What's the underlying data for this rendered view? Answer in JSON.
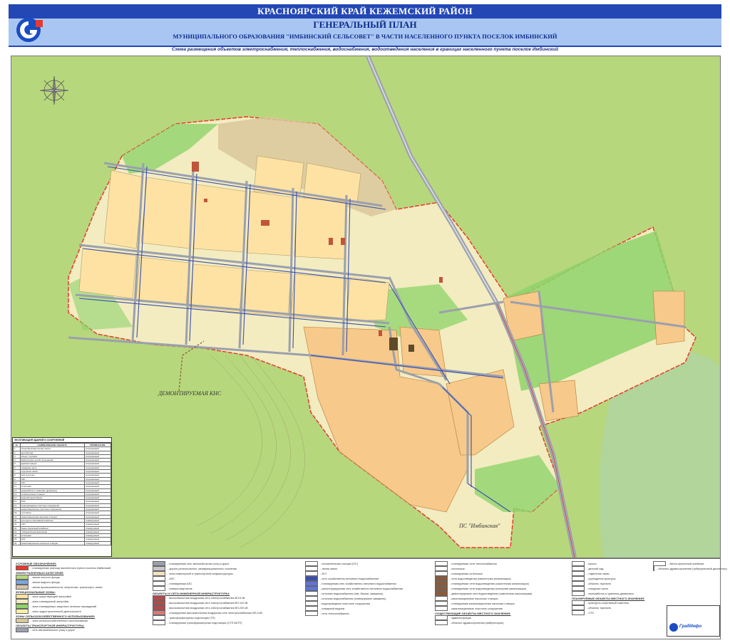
{
  "header": {
    "region": "КРАСНОЯРСКИЙ КРАЙ КЕЖЕМСКИЙ РАЙОН",
    "title": "ГЕНЕРАЛЬНЫЙ ПЛАН",
    "subtitle": "МУНИЦИПАЛЬНОГО ОБРАЗОВАНИЯ \"ИМБИНСКИЙ СЕЛЬСОВЕТ\" В ЧАСТИ НАСЕЛЕННОГО ПУНКТА ПОСЕЛОК ИМБИНСКИЙ",
    "scheme": "Схема размещения объектов электроснабжения, теплоснабжения, водоснабжения, водоотведения населения в границах населенного пункта поселок Имбинский"
  },
  "map_labels": {
    "demolished": "ДЕМОНТИРУЕМАЯ КНС",
    "substation": "ПС \"Имбинская\""
  },
  "colors": {
    "header_dark": "#2347b5",
    "header_light": "#a9c6f3",
    "forest": "#b7d77c",
    "residential": "#fde2a3",
    "public": "#f7c98a",
    "green_zone": "#8ed46a",
    "road": "#9aa0ad",
    "engineering_line": "#3a4fb0",
    "border": "#e53b2e"
  },
  "explication": {
    "title": "ЭКСПЛИКАЦИЯ ЗДАНИЙ И СООРУЖЕНИЙ",
    "columns": [
      "№",
      "НАИМЕНОВАНИЕ ОБЪЕКТА",
      "ПРИМЕЧАНИЕ"
    ],
    "rows": [
      [
        "1",
        "общеобразовательная школа",
        "сохраняемый"
      ],
      [
        "2",
        "детский сад",
        "сохраняемый"
      ],
      [
        "3",
        "объект торговли",
        "сохраняемый"
      ],
      [
        "4",
        "амбулатория (на 40 посещений)",
        "сохраняемый"
      ],
      [
        "5",
        "администрация",
        "сохраняемый"
      ],
      [
        "6",
        "пожарная часть",
        "сохраняемый"
      ],
      [
        "7",
        "отделение связи",
        "сохраняемый"
      ],
      [
        "8",
        "дом культуры",
        "сохраняемый"
      ],
      [
        "9",
        "АЗС",
        "сохраняемый"
      ],
      [
        "10",
        "АТС",
        "сохраняемый"
      ],
      [
        "11",
        "котельная",
        "сохраняемый"
      ],
      [
        "12",
        "переработка и хранение древесины",
        "сохраняемый"
      ],
      [
        "13",
        "понизительная станция",
        "сохраняемый"
      ],
      [
        "14",
        "водонапорная башня",
        "сохраняемый"
      ],
      [
        "15",
        "КНС",
        "сохраняемый"
      ],
      [
        "16",
        "водопроводные очистные сооружения",
        "сохраняемый"
      ],
      [
        "17",
        "канализационные очистные сооружения",
        "сохраняемый"
      ],
      [
        "18",
        "гостиница",
        "сохраняемый"
      ],
      [
        "19",
        "канализационная насосная станция",
        "сохраняемый"
      ],
      [
        "20",
        "культурно-спортивный комплекс",
        "планируемый"
      ],
      [
        "21",
        "СТО",
        "планируемый"
      ],
      [
        "22",
        "банно-прачечный комбинат",
        "планируемый"
      ],
      [
        "23",
        "туберкулёзный диспансер",
        "планируемый"
      ],
      [
        "24",
        "котельная",
        "планируемый"
      ],
      [
        "25",
        "КНС",
        "планируемый"
      ],
      [
        "26",
        "канализационные насосные станции",
        "планируемый"
      ]
    ]
  },
  "legend": {
    "col1": {
      "heading": "УСЛОВНЫЕ ОБОЗНАЧЕНИЯ:",
      "items": [
        {
          "sw": "#e53b2e",
          "text": "- планируемая граница населенного пункта поселок Имбинский"
        },
        {
          "head": "ЗЕМЛИ РАЗЛИЧНЫХ КАТЕГОРИЙ:"
        },
        {
          "sw": "#b7d77c",
          "text": "- земли лесного фонда"
        },
        {
          "sw": "#7aa7e0",
          "text": "- земли водного фонда"
        },
        {
          "sw": "#d6c3a8",
          "text": "- земли промышленности, энергетики, транспорта, связи"
        },
        {
          "head": "ФУНКЦИОНАЛЬНЫЕ ЗОНЫ:"
        },
        {
          "sw": "#fde2a3",
          "text": "- зона существующей застройки"
        },
        {
          "sw": "#f3ecc0",
          "text": "- зона планируемой застройки"
        },
        {
          "sw": "#8ed46a",
          "text": "- зона планируемых защитных зеленых насаждений"
        },
        {
          "sw": "#f9f1a6",
          "text": "- зона градостроительной деятельности"
        },
        {
          "head": "ЗОНЫ СЕЛЬСКОХОЗЯЙСТВЕННОГО ИСПОЛЬЗОВАНИЯ:"
        },
        {
          "sw": "#d9c89a",
          "text": "- зона сельскохозяйственного использования"
        },
        {
          "head": "ОБЪЕКТЫ ТРАНСПОРТНОЙ ИНФРАСТРУКТУРЫ:"
        },
        {
          "sw": "#9aa0ad",
          "text": "- сеть автомобильных улиц и дорог"
        }
      ]
    },
    "col2": {
      "items": [
        {
          "sw": "#9aa0ad",
          "text": "- планируемая сеть автомобильных улиц и дорог"
        },
        {
          "sw": "#c8c8c8",
          "text": "- дороги регионального, межмуниципального значения"
        },
        {
          "sw": "#efe3c0",
          "text": "- зона инженерной и транспортной инфраструктуры"
        },
        {
          "sw": "#ffffff",
          "text": "- АЗС"
        },
        {
          "sw": "#ffffff",
          "text": "- планируемая АЗС"
        },
        {
          "sw": "#ffffff",
          "text": "- номера кварталов"
        },
        {
          "head": "ОБЪЕКТЫ И СЕТИ ИНЖЕНЕРНОЙ ИНФРАСТРУКТУРЫ:"
        },
        {
          "sw": "#b34a4a",
          "text": "- высоковольтная воздушная сеть электроснабжения ВЛ-6 кВ"
        },
        {
          "sw": "#b34a4a",
          "text": "- высоковольтная воздушная сеть электроснабжения ВЛ-110 кВ"
        },
        {
          "sw": "#b34a4a",
          "text": "- высоковольтная воздушная сеть электроснабжения ВЛ-220 кВ"
        },
        {
          "sw": "#d97a7a",
          "text": "- планируемая высоковольтная воздушная сеть электроснабжения ВЛ-6 кВ"
        },
        {
          "sw": "#ffffff",
          "text": "- трансформаторная подстанция (ТП)"
        },
        {
          "sw": "#ffffff",
          "text": "- планируемая трансформаторная подстанция (СТП,БКТП)"
        }
      ]
    },
    "col3": {
      "items": [
        {
          "sw": "#ffffff",
          "text": "- понизительная станция (ПС)"
        },
        {
          "sw": "#ffffff",
          "text": "- линия связи"
        },
        {
          "sw": "#ffffff",
          "text": "- АТС"
        },
        {
          "sw": "#3a4fb0",
          "text": "- сеть хозяйственно-питьевого водоснабжения"
        },
        {
          "sw": "#5f74d6",
          "text": "- планируемая сеть хозяйственно-питьевого водоснабжения"
        },
        {
          "sw": "#5f74d6",
          "text": "- реконструируемая сеть хозяйственно-питьевого водоснабжения"
        },
        {
          "sw": "#ffffff",
          "text": "- источник водоснабжения (скв. башня, скважины)"
        },
        {
          "sw": "#ffffff",
          "text": "- источник водоснабжения (планируемые скважины)"
        },
        {
          "sw": "#ffffff",
          "text": "- водопроводные очистные сооружения"
        },
        {
          "sw": "#ffffff",
          "text": "- пожарный водоем"
        },
        {
          "sw": "#ffffff",
          "text": "- сети теплоснабжения"
        }
      ]
    },
    "col4": {
      "items": [
        {
          "sw": "#ffffff",
          "text": "- планируемые сети теплоснабжения"
        },
        {
          "sw": "#ffffff",
          "text": "- котельные"
        },
        {
          "sw": "#ffffff",
          "text": "- планируемые котельные"
        },
        {
          "sw": "#8a5a3a",
          "text": "- сети водоотведения (самотечная канализация)"
        },
        {
          "sw": "#8a5a3a",
          "text": "- планируемые сети водоотведения (самотечная канализация)"
        },
        {
          "sw": "#8a5a3a",
          "text": "- планируемые сети водоотведения (напорная канализация)"
        },
        {
          "sw": "#8a5a3a",
          "text": "- демонтируемые сети водоотведения (самотечная канализация)"
        },
        {
          "sw": "#ffffff",
          "text": "- канализационные насосные станции"
        },
        {
          "sw": "#ffffff",
          "text": "- планируемая канализационная насосная станция"
        },
        {
          "sw": "#ffffff",
          "text": "- канализационные очистные сооружения"
        },
        {
          "head": "СУЩЕСТВУЮЩИЕ ОБЪЕКТЫ МЕСТНОГО ЗНАЧЕНИЯ:"
        },
        {
          "sw": "#ffffff",
          "text": "- администрация"
        },
        {
          "sw": "#ffffff",
          "text": "- объекты здравоохранения (амбулатория)"
        }
      ]
    },
    "col5": {
      "items": [
        {
          "sw": "#ffffff",
          "text": "- школа"
        },
        {
          "sw": "#ffffff",
          "text": "- детский сад"
        },
        {
          "sw": "#ffffff",
          "text": "- отделение связи"
        },
        {
          "sw": "#ffffff",
          "text": "- учреждения культуры"
        },
        {
          "sw": "#ffffff",
          "text": "- объекты торговли"
        },
        {
          "sw": "#ffffff",
          "text": "- пожарная часть"
        },
        {
          "sw": "#ffffff",
          "text": "- переработка и хранение древесины"
        },
        {
          "head": "ПЛАНИРУЕМЫЕ ОБЪЕКТЫ МЕСТНОГО ЗНАЧЕНИЯ:"
        },
        {
          "sw": "#ffffff",
          "text": "- культурно-спортивный комплекс"
        },
        {
          "sw": "#ffffff",
          "text": "- объекты торговли"
        },
        {
          "sw": "#ffffff",
          "text": "- СТО"
        }
      ]
    },
    "col6": {
      "items": [
        {
          "sw": "#ffffff",
          "text": "- банно-прачечный комбинат"
        },
        {
          "sw": "#ffffff",
          "text": "- объекты здравоохранения (туберкулезный диспансер)"
        }
      ]
    }
  },
  "stamp": {
    "brand": "ГрадИнфо"
  }
}
